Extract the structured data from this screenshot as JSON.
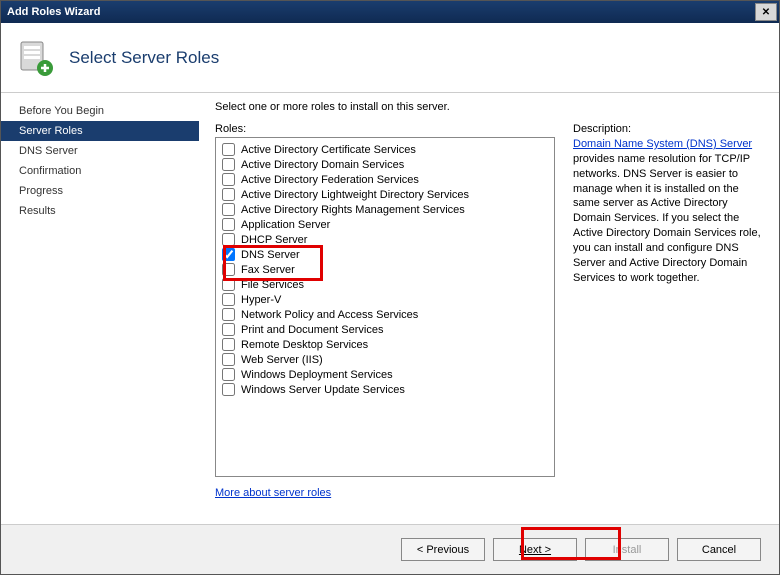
{
  "titlebar": {
    "title": "Add Roles Wizard"
  },
  "header": {
    "title": "Select Server Roles"
  },
  "sidebar": {
    "items": [
      {
        "label": "Before You Begin",
        "active": false
      },
      {
        "label": "Server Roles",
        "active": true
      },
      {
        "label": "DNS Server",
        "active": false
      },
      {
        "label": "Confirmation",
        "active": false
      },
      {
        "label": "Progress",
        "active": false
      },
      {
        "label": "Results",
        "active": false
      }
    ]
  },
  "main": {
    "instruction": "Select one or more roles to install on this server.",
    "roles_label": "Roles:",
    "description_label": "Description:",
    "description_link": "Domain Name System (DNS) Server",
    "description_text": " provides name resolution for TCP/IP networks. DNS Server is easier to manage when it is installed on the same server as Active Directory Domain Services. If you select the Active Directory Domain Services role, you can install and configure DNS Server and Active Directory Domain Services to work together.",
    "more_link": "More about server roles",
    "roles": [
      {
        "label": "Active Directory Certificate Services",
        "checked": false
      },
      {
        "label": "Active Directory Domain Services",
        "checked": false
      },
      {
        "label": "Active Directory Federation Services",
        "checked": false
      },
      {
        "label": "Active Directory Lightweight Directory Services",
        "checked": false
      },
      {
        "label": "Active Directory Rights Management Services",
        "checked": false
      },
      {
        "label": "Application Server",
        "checked": false
      },
      {
        "label": "DHCP Server",
        "checked": false
      },
      {
        "label": "DNS Server",
        "checked": true
      },
      {
        "label": "Fax Server",
        "checked": false
      },
      {
        "label": "File Services",
        "checked": false
      },
      {
        "label": "Hyper-V",
        "checked": false
      },
      {
        "label": "Network Policy and Access Services",
        "checked": false
      },
      {
        "label": "Print and Document Services",
        "checked": false
      },
      {
        "label": "Remote Desktop Services",
        "checked": false
      },
      {
        "label": "Web Server (IIS)",
        "checked": false
      },
      {
        "label": "Windows Deployment Services",
        "checked": false
      },
      {
        "label": "Windows Server Update Services",
        "checked": false
      }
    ]
  },
  "footer": {
    "previous": "< Previous",
    "next": "Next >",
    "install": "Install",
    "cancel": "Cancel"
  }
}
